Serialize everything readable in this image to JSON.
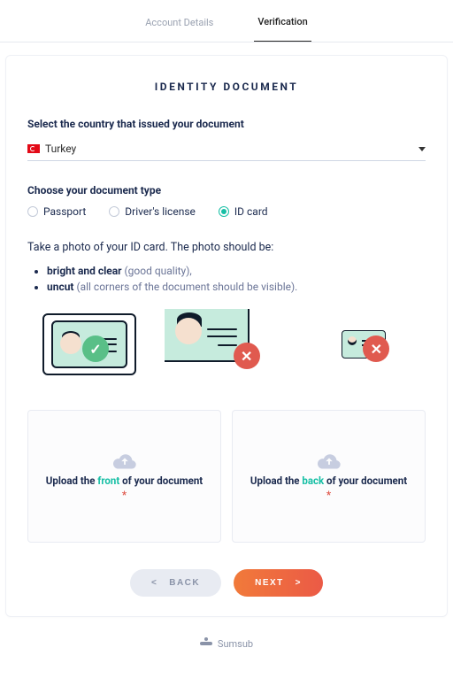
{
  "tabs": {
    "account": "Account Details",
    "verification": "Verification"
  },
  "title": "IDENTITY DOCUMENT",
  "country": {
    "label": "Select the country that issued your document",
    "selected": "Turkey"
  },
  "doctype": {
    "label": "Choose your document type",
    "options": {
      "passport": "Passport",
      "drivers": "Driver's license",
      "idcard": "ID card"
    },
    "selected": "idcard"
  },
  "instruction": "Take a photo of your ID card. The photo should be:",
  "requirements": {
    "r1_bold": "bright and clear",
    "r1_rest": " (good quality),",
    "r2_bold": "uncut",
    "r2_rest": " (all corners of the document should be visible)."
  },
  "upload": {
    "front_pre": "Upload the ",
    "front_word": "front",
    "front_post": " of your document ",
    "back_pre": "Upload the ",
    "back_word": "back",
    "back_post": " of your document "
  },
  "buttons": {
    "back": "BACK",
    "next": "NEXT"
  },
  "brand": "Sumsub"
}
